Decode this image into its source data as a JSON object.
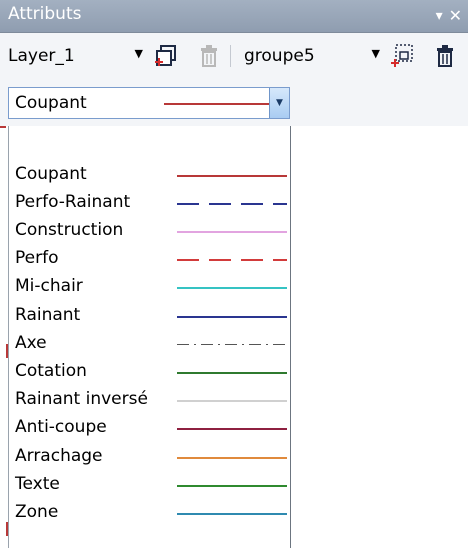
{
  "window": {
    "title": "Attributs",
    "pin_icon": "pin-down-icon",
    "close_icon": "close-icon"
  },
  "toolbar": {
    "layer_value": "Layer_1",
    "group_value": "groupe5"
  },
  "type_select": {
    "value": "Coupant",
    "line_color": "#b83838"
  },
  "line_types": [
    {
      "label": "Coupant",
      "color": "#b83838",
      "style": "solid"
    },
    {
      "label": "Perfo-Rainant",
      "color": "#2a3590",
      "style": "dashed"
    },
    {
      "label": "Construction",
      "color": "#e2a4e0",
      "style": "solid"
    },
    {
      "label": "Perfo",
      "color": "#d23b3b",
      "style": "dashed"
    },
    {
      "label": "Mi-chair",
      "color": "#35c3c3",
      "style": "solid"
    },
    {
      "label": "Rainant",
      "color": "#2a3590",
      "style": "solid"
    },
    {
      "label": "Axe",
      "color": "#555555",
      "style": "dashdot"
    },
    {
      "label": "Cotation",
      "color": "#2f7a2f",
      "style": "solid"
    },
    {
      "label": "Rainant inversé",
      "color": "#d0d0d0",
      "style": "solid"
    },
    {
      "label": "Anti-coupe",
      "color": "#8e2040",
      "style": "solid"
    },
    {
      "label": "Arrachage",
      "color": "#e08a3c",
      "style": "solid"
    },
    {
      "label": "Texte",
      "color": "#2f8a2f",
      "style": "solid"
    },
    {
      "label": "Zone",
      "color": "#2f8ab0",
      "style": "solid"
    }
  ]
}
